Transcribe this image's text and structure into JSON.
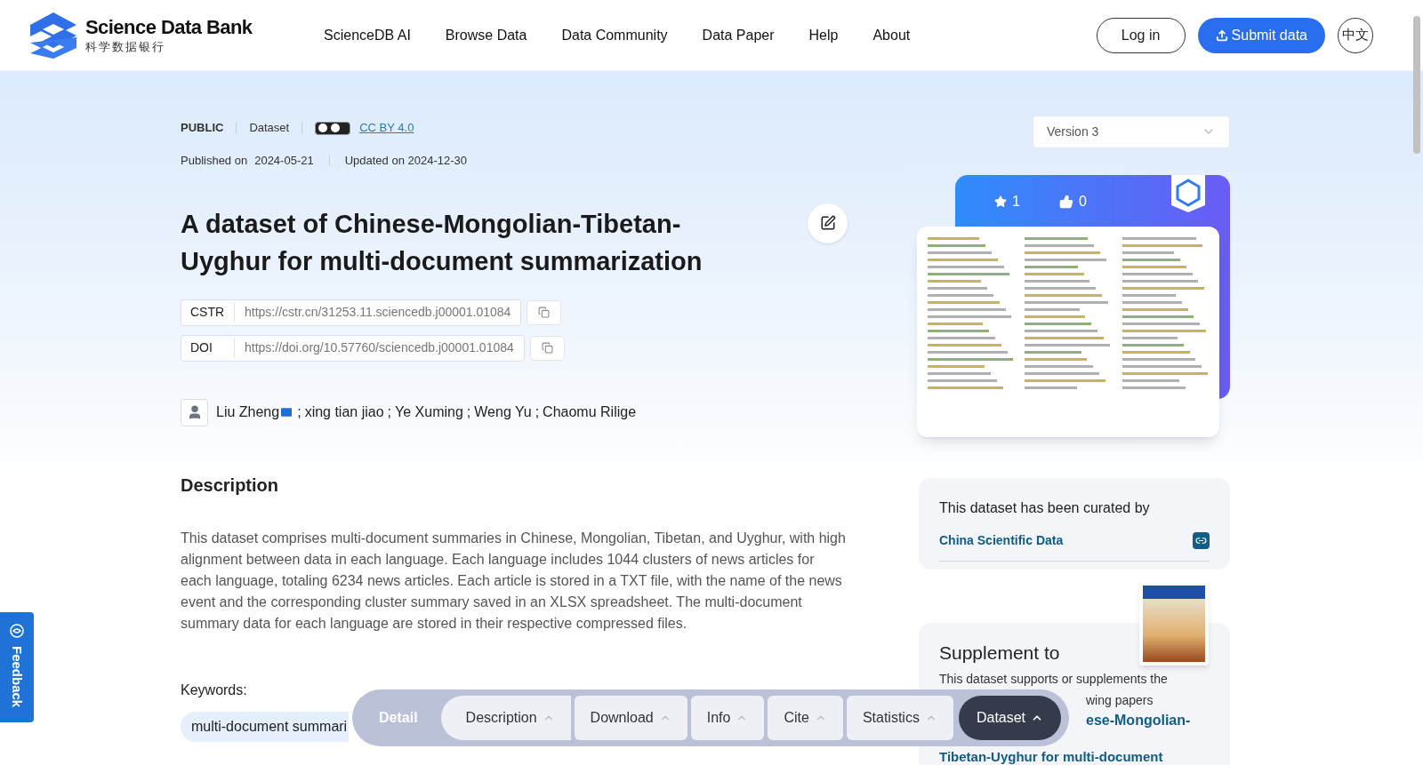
{
  "header": {
    "logo_title": "Science Data Bank",
    "logo_subtitle": "科学数据银行",
    "nav": [
      "ScienceDB AI",
      "Browse Data",
      "Data Community",
      "Data Paper",
      "Help",
      "About"
    ],
    "login": "Log in",
    "submit": "Submit data",
    "language": "中文"
  },
  "meta": {
    "access": "PUBLIC",
    "type": "Dataset",
    "license": "CC BY 4.0",
    "published_label": "Published on",
    "published": "2024-05-21",
    "updated": "Updated on 2024-12-30"
  },
  "title": "A dataset of Chinese-Mongolian-Tibetan-Uyghur for multi-document summarization",
  "identifiers": [
    {
      "label": "CSTR",
      "value": "https://cstr.cn/31253.11.sciencedb.j00001.01084"
    },
    {
      "label": "DOI",
      "value": "https://doi.org/10.57760/sciencedb.j00001.01084"
    }
  ],
  "authors": {
    "separator": ";",
    "items": [
      {
        "name": "Liu Zheng",
        "email": true
      },
      {
        "name": "xing tian jiao",
        "email": false
      },
      {
        "name": "Ye Xuming",
        "email": false
      },
      {
        "name": "Weng Yu",
        "email": false
      },
      {
        "name": "Chaomu Rilige",
        "email": false
      }
    ]
  },
  "description": {
    "heading": "Description",
    "text": "This dataset comprises multi-document summaries in Chinese, Mongolian, Tibetan, and Uyghur, with high alignment between data in each language. Each language includes 1044 clusters of news articles for each language, totaling 6234 news articles. Each article is stored in a TXT file, with the name of the news event and the corresponding cluster summary saved in an XLSX spreadsheet. The multi-document summary data for each language are stored in their respective compressed files."
  },
  "keywords": {
    "label": "Keywords:",
    "items": [
      "multi-document summari"
    ]
  },
  "version": {
    "value": "Version 3"
  },
  "stats": {
    "stars": "1",
    "likes": "0"
  },
  "curated": {
    "text": "This dataset has been curated by",
    "org": "China Scientific Data"
  },
  "supplement": {
    "heading": "Supplement to",
    "lines": [
      "This dataset supports or supplements the",
      "wing papers"
    ],
    "paper_lines": [
      "ese-Mongolian-",
      "Tibetan-Uyghur for multi-document"
    ]
  },
  "feedback": "Feedback",
  "bottom_nav": {
    "label": "Detail",
    "items": [
      {
        "label": "Description",
        "selected": false
      },
      {
        "label": "Download",
        "selected": false
      },
      {
        "label": "Info",
        "selected": false
      },
      {
        "label": "Cite",
        "selected": false
      },
      {
        "label": "Statistics",
        "selected": false
      },
      {
        "label": "Dataset",
        "selected": true
      }
    ]
  }
}
